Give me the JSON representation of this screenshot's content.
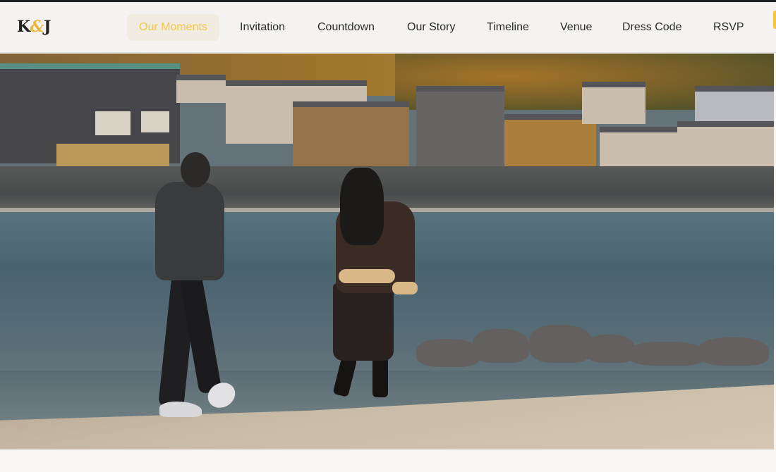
{
  "brand": {
    "logo_left": "K",
    "logo_amp": "&",
    "logo_right": "J"
  },
  "nav": {
    "items": [
      {
        "label": "Our Moments",
        "active": true
      },
      {
        "label": "Invitation",
        "active": false
      },
      {
        "label": "Countdown",
        "active": false
      },
      {
        "label": "Our Story",
        "active": false
      },
      {
        "label": "Timeline",
        "active": false
      },
      {
        "label": "Venue",
        "active": false
      },
      {
        "label": "Dress Code",
        "active": false
      },
      {
        "label": "RSVP",
        "active": false
      }
    ]
  },
  "colors": {
    "accent": "#f4c542",
    "nav_bg": "#f4f3f1",
    "page_bg": "#f7f6f3",
    "text": "#2b2b2b"
  }
}
